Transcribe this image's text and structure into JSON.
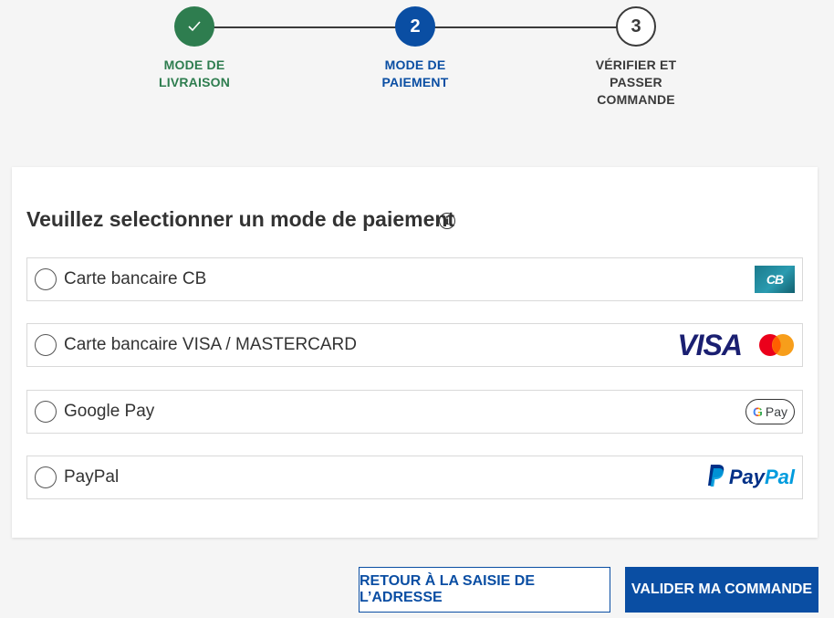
{
  "stepper": {
    "steps": [
      {
        "number": "",
        "state": "done",
        "lines": [
          "MODE DE",
          "LIVRAISON"
        ]
      },
      {
        "number": "2",
        "state": "active",
        "lines": [
          "MODE DE",
          "PAIEMENT"
        ]
      },
      {
        "number": "3",
        "state": "pending",
        "lines": [
          "VÉRIFIER ET",
          "PASSER",
          "COMMANDE"
        ]
      }
    ]
  },
  "payment": {
    "title": "Veuillez selectionner un mode de paiement",
    "info_icon": "i",
    "options": [
      {
        "label": "Carte bancaire CB",
        "logo": "cb-logo",
        "logo_text": "CB"
      },
      {
        "label": "Carte bancaire VISA / MASTERCARD",
        "logo": "visa-mastercard-logo",
        "logo_text": "VISA"
      },
      {
        "label": "Google Pay",
        "logo": "google-pay-logo",
        "logo_text": "G Pay"
      },
      {
        "label": "PayPal",
        "logo": "paypal-logo",
        "logo_text": "PayPal"
      }
    ]
  },
  "buttons": {
    "back_label": "RETOUR À LA SAISIE DE L’ADRESSE",
    "submit_label": "VALIDER MA COMMANDE"
  },
  "colors": {
    "done": "#2e7d4f",
    "active": "#0a4ea3",
    "pending_border": "#3a3a3a",
    "visa": "#1a1f71",
    "mc_red": "#eb001b",
    "mc_yellow": "#f79e1b",
    "paypal_dark": "#003087",
    "paypal_light": "#009cde",
    "cb_teal": "#1b7a8c"
  }
}
